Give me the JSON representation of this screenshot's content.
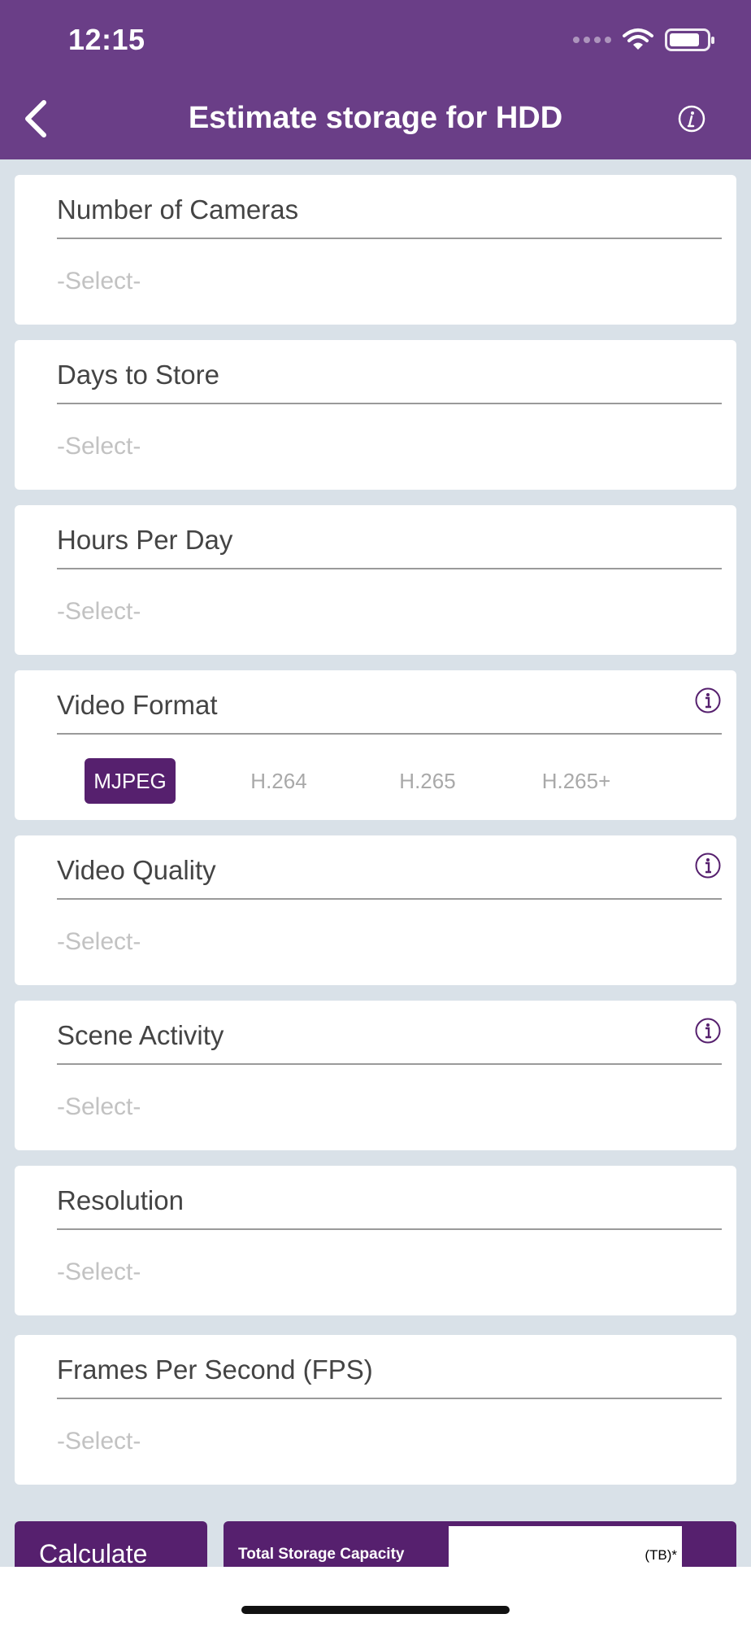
{
  "status_bar": {
    "time": "12:15"
  },
  "header": {
    "title": "Estimate storage for HDD"
  },
  "fields": [
    {
      "label": "Number of Cameras",
      "value": "-Select-"
    },
    {
      "label": "Days to Store",
      "value": "-Select-"
    },
    {
      "label": "Hours Per Day",
      "value": "-Select-"
    },
    {
      "label": "Video Format",
      "options": [
        "MJPEG",
        "H.264",
        "H.265",
        "H.265+"
      ],
      "selected": "MJPEG"
    },
    {
      "label": "Video Quality",
      "value": "-Select-"
    },
    {
      "label": "Scene Activity",
      "value": "-Select-"
    },
    {
      "label": "Resolution",
      "value": "-Select-"
    },
    {
      "label": "Frames Per Second (FPS)",
      "value": "-Select-"
    }
  ],
  "footer": {
    "calculate_label": "Calculate",
    "total_label": "Total Storage Capacity",
    "unit_label": "(TB)*"
  },
  "colors": {
    "header": "#6a3e87",
    "accent": "#56206e",
    "background": "#d9e1e8"
  },
  "icons": [
    "back-icon",
    "info-icon",
    "wifi-icon",
    "battery-icon"
  ]
}
